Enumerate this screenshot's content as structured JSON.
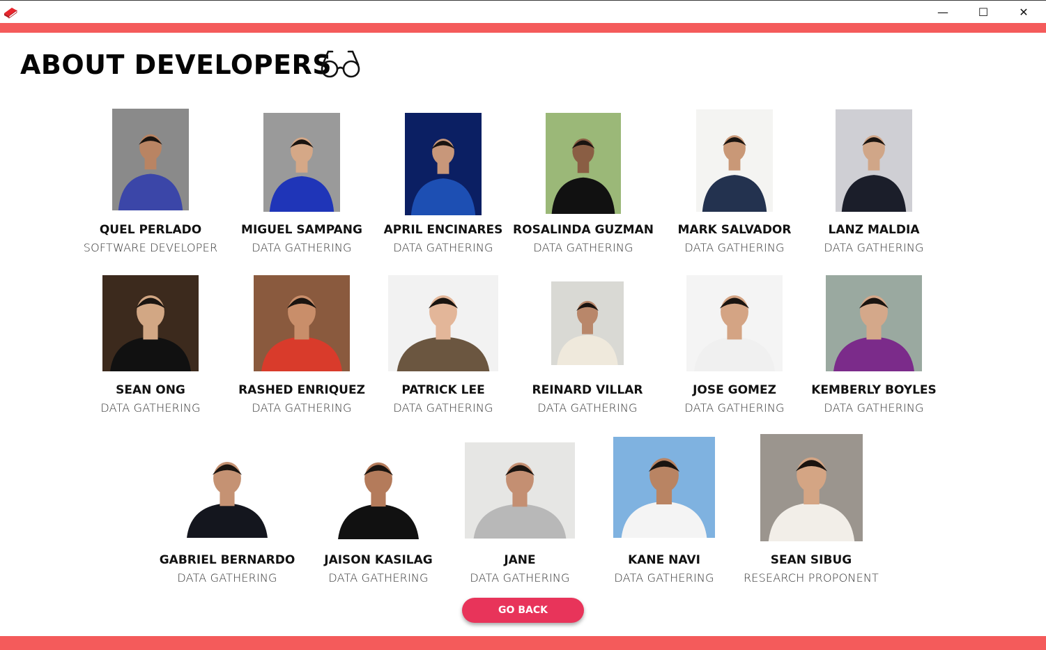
{
  "window": {
    "minimize_glyph": "—",
    "maximize_glyph": "☐",
    "close_glyph": "✕"
  },
  "page": {
    "title": "ABOUT DEVELOPERS"
  },
  "colors": {
    "accent_bar": "#f45b5b",
    "button": "#e8345a"
  },
  "developers": [
    {
      "name": "QUEL PERLADO",
      "role": "SOFTWARE DEVELOPER"
    },
    {
      "name": "MIGUEL SAMPANG",
      "role": "DATA GATHERING"
    },
    {
      "name": "APRIL ENCINARES",
      "role": "DATA GATHERING"
    },
    {
      "name": "ROSALINDA GUZMAN",
      "role": "DATA GATHERING"
    },
    {
      "name": "MARK SALVADOR",
      "role": "DATA GATHERING"
    },
    {
      "name": "LANZ MALDIA",
      "role": "DATA GATHERING"
    },
    {
      "name": "SEAN ONG",
      "role": "DATA GATHERING"
    },
    {
      "name": "RASHED ENRIQUEZ",
      "role": "DATA GATHERING"
    },
    {
      "name": "PATRICK LEE",
      "role": "DATA GATHERING"
    },
    {
      "name": "REINARD VILLAR",
      "role": "DATA GATHERING"
    },
    {
      "name": "JOSE GOMEZ",
      "role": "DATA GATHERING"
    },
    {
      "name": "KEMBERLY BOYLES",
      "role": "DATA GATHERING"
    },
    {
      "name": "GABRIEL BERNARDO",
      "role": "DATA GATHERING"
    },
    {
      "name": "JAISON KASILAG",
      "role": "DATA GATHERING"
    },
    {
      "name": "JANE",
      "role": "DATA GATHERING"
    },
    {
      "name": "KANE NAVI",
      "role": "DATA GATHERING"
    },
    {
      "name": "SEAN SIBUG",
      "role": "RESEARCH PROPONENT"
    }
  ],
  "buttons": {
    "go_back": "GO BACK"
  }
}
